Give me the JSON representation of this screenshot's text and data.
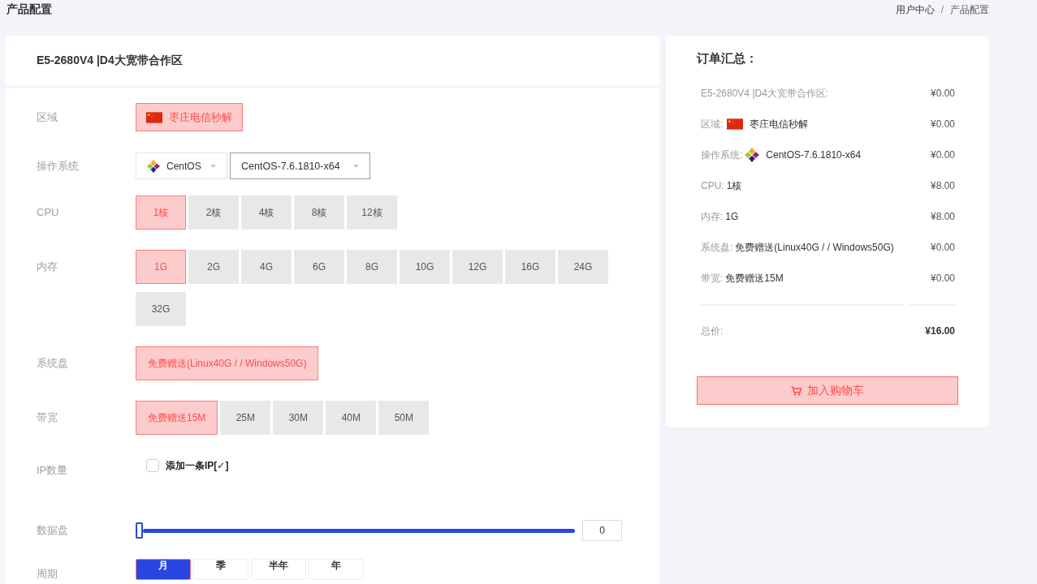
{
  "header": {
    "title": "产品配置",
    "breadcrumb": {
      "items": [
        {
          "label": "用户中心",
          "kind": "link"
        },
        {
          "label": "产品配置",
          "kind": "current"
        }
      ],
      "separator": "/"
    }
  },
  "product": {
    "title": "E5-2680V4 |D4大宽带合作区"
  },
  "config": [
    {
      "kind": "region",
      "label": "区域",
      "options": [
        {
          "label": "枣庄电信秒解",
          "selected": true
        }
      ]
    },
    {
      "kind": "os",
      "label": "操作系统",
      "selects": [
        {
          "kind": "family",
          "value": "CentOS",
          "focused": false
        },
        {
          "kind": "version",
          "value": "CentOS-7.6.1810-x64",
          "focused": true
        }
      ]
    },
    {
      "kind": "options",
      "label": "CPU",
      "options": [
        {
          "label": "1核",
          "selected": true
        },
        {
          "label": "2核",
          "selected": false
        },
        {
          "label": "4核",
          "selected": false
        },
        {
          "label": "8核",
          "selected": false
        },
        {
          "label": "12核",
          "selected": false
        }
      ]
    },
    {
      "kind": "options",
      "label": "内存",
      "options": [
        {
          "label": "1G",
          "selected": true
        },
        {
          "label": "2G",
          "selected": false
        },
        {
          "label": "4G",
          "selected": false
        },
        {
          "label": "6G",
          "selected": false
        },
        {
          "label": "8G",
          "selected": false
        },
        {
          "label": "10G",
          "selected": false
        },
        {
          "label": "12G",
          "selected": false
        },
        {
          "label": "16G",
          "selected": false
        },
        {
          "label": "24G",
          "selected": false
        },
        {
          "label": "32G",
          "selected": false
        }
      ]
    },
    {
      "kind": "options",
      "label": "系统盘",
      "options": [
        {
          "label": "免费赠送(Linux40G / / Windows50G)",
          "selected": true
        }
      ]
    },
    {
      "kind": "options",
      "label": "带宽",
      "options": [
        {
          "label": "免费赠送15M",
          "selected": true
        },
        {
          "label": "25M",
          "selected": false
        },
        {
          "label": "30M",
          "selected": false
        },
        {
          "label": "40M",
          "selected": false
        },
        {
          "label": "50M",
          "selected": false
        }
      ]
    },
    {
      "kind": "checkbox",
      "label": "IP数量",
      "text": "添加一条IP[✓]",
      "checked": false
    },
    {
      "kind": "slider",
      "label": "数据盘",
      "level": 0,
      "value": "0"
    },
    {
      "kind": "cycle",
      "label": "周期",
      "options": [
        {
          "label": "月",
          "selected": true
        },
        {
          "label": "季",
          "selected": false
        },
        {
          "label": "半年",
          "selected": false
        },
        {
          "label": "年",
          "selected": false
        }
      ]
    }
  ],
  "summary": {
    "title": "订单汇总：",
    "items": [
      {
        "kind": "plain",
        "label": "E5-2680V4 |D4大宽带合作区:",
        "price": "¥0.00"
      },
      {
        "kind": "region",
        "label": "区域:",
        "value": "枣庄电信秒解",
        "price": "¥0.00"
      },
      {
        "kind": "os",
        "label": "操作系统:",
        "value": "CentOS-7.6.1810-x64",
        "price": "¥0.00"
      },
      {
        "kind": "plain",
        "label": "CPU:",
        "value": "1核",
        "price": "¥8.00"
      },
      {
        "kind": "plain",
        "label": "内存:",
        "value": "1G",
        "price": "¥8.00"
      },
      {
        "kind": "plain",
        "label": "系统盘:",
        "value": "免费赠送(Linux40G / / Windows50G)",
        "price": "¥0.00"
      },
      {
        "kind": "plain",
        "label": "带宽:",
        "value": "免费赠送15M",
        "price": "¥0.00"
      }
    ],
    "total_label": "总价:",
    "total": "¥16.00",
    "button": "加入购物车"
  }
}
